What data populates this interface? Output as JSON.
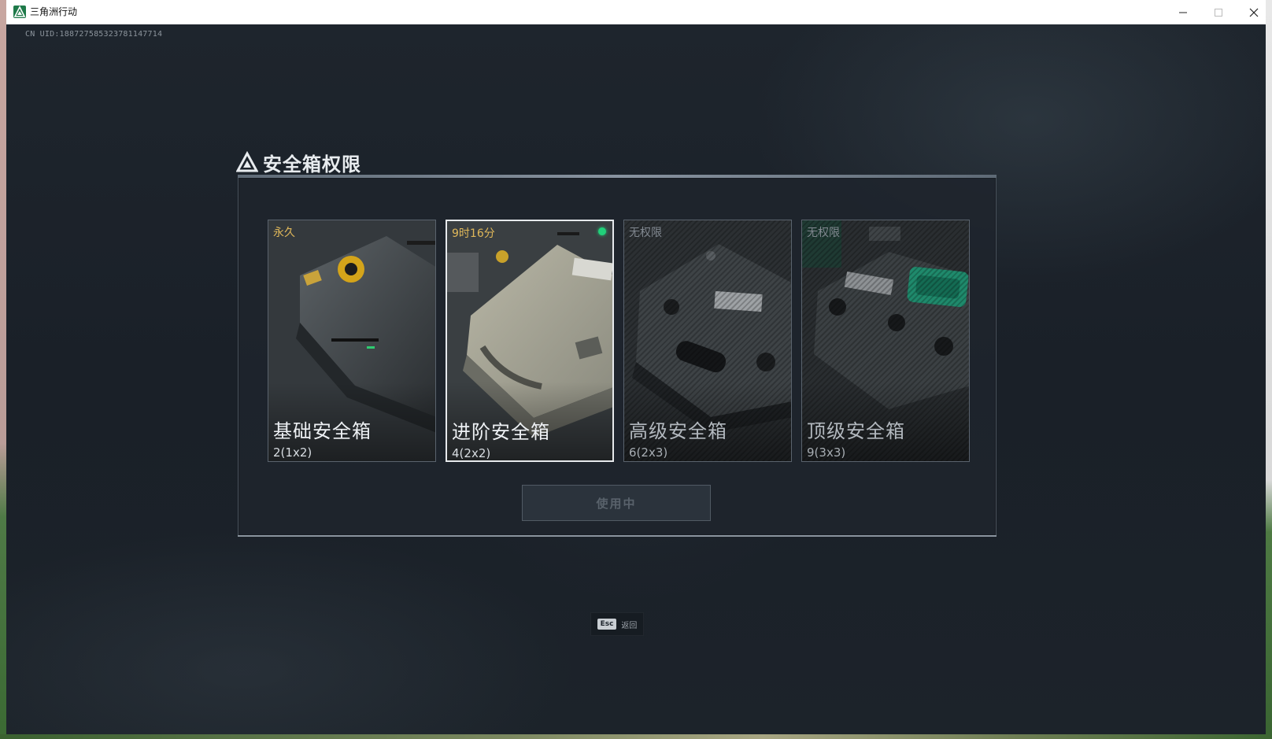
{
  "window": {
    "title": "三角洲行动",
    "controls": [
      "minimize",
      "maximize",
      "close"
    ]
  },
  "uid_text": "CN UID:188727585323781147714",
  "panel": {
    "title": "安全箱权限",
    "cards": [
      {
        "status": "永久",
        "name": "基础安全箱",
        "capacity": "2(1x2)",
        "locked": false,
        "selected": false
      },
      {
        "status": "9时16分",
        "name": "进阶安全箱",
        "capacity": "4(2x2)",
        "locked": false,
        "selected": true,
        "active": true
      },
      {
        "status": "无权限",
        "name": "高级安全箱",
        "capacity": "6(2x3)",
        "locked": true,
        "selected": false
      },
      {
        "status": "无权限",
        "name": "顶级安全箱",
        "capacity": "9(3x3)",
        "locked": true,
        "selected": false
      }
    ],
    "action_button": "使用中"
  },
  "esc_hint": {
    "key": "Esc",
    "label": "返回"
  },
  "colors": {
    "accent_gold": "#e0b85a",
    "active_green": "#21d07a",
    "background": "#1c232c"
  }
}
